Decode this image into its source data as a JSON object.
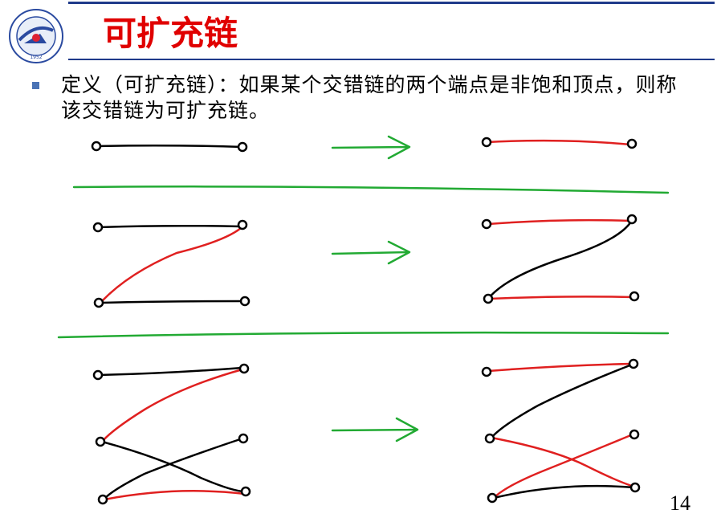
{
  "slide": {
    "title": "可扩充链",
    "definition": "定义（可扩充链）：如果某个交错链的两个端点是非饱和顶点，则称该交错链为可扩充链。",
    "page_number": "14"
  },
  "colors": {
    "title_red": "#e00000",
    "header_blue": "#1f3a8a",
    "bullet_blue": "#4a73b5",
    "matched_edge_red": "#e02020",
    "unmatched_edge_black": "#000000",
    "arrow_green": "#22aa33"
  },
  "icons": {
    "logo": "university-seal-icon",
    "bullet": "square-bullet-icon",
    "arrow": "right-arrow-icon"
  }
}
